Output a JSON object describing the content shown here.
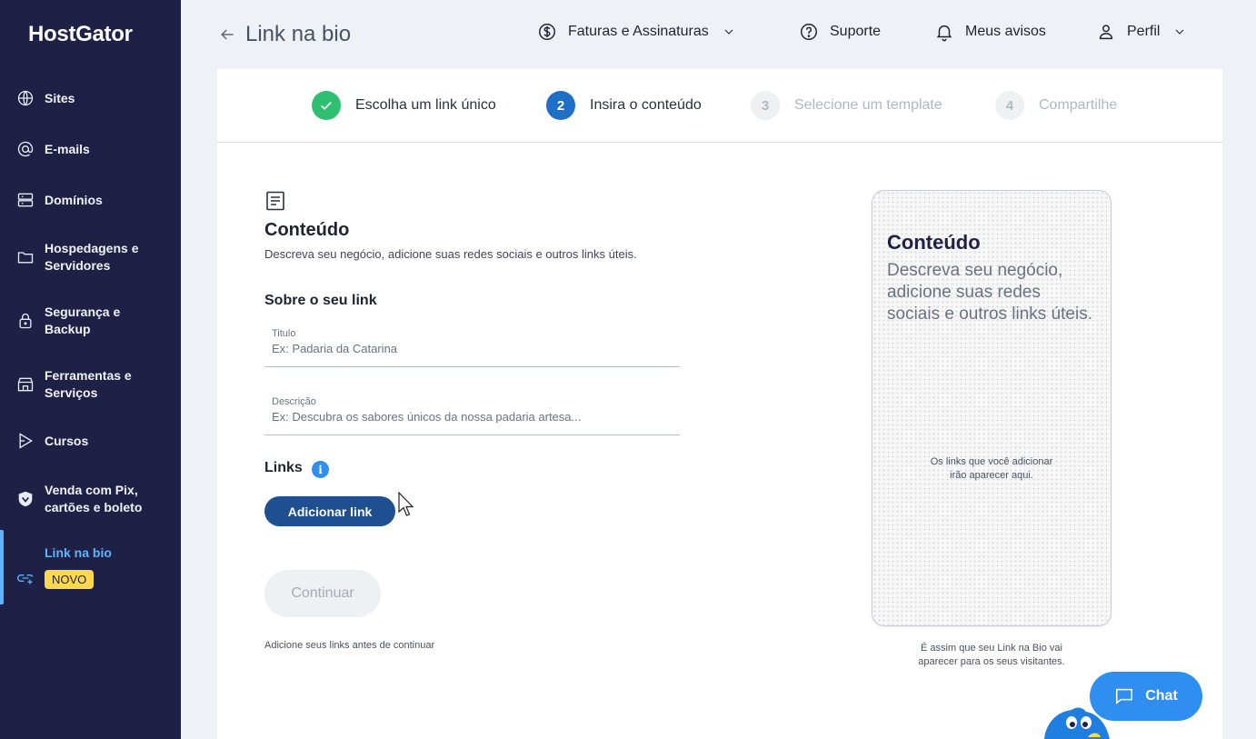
{
  "brand": {
    "logo": "HostGator"
  },
  "sidebar": {
    "items": [
      {
        "label": "Sites",
        "icon": "globe-icon"
      },
      {
        "label": "E-mails",
        "icon": "at-icon"
      },
      {
        "label": "Domínios",
        "icon": "server-icon"
      },
      {
        "label": "Hospedagens e Servidores",
        "icon": "folder-icon"
      },
      {
        "label": "Segurança e Backup",
        "icon": "lock-icon"
      },
      {
        "label": "Ferramentas e Serviços",
        "icon": "store-icon"
      },
      {
        "label": "Cursos",
        "icon": "play-icon"
      },
      {
        "label": "Venda com Pix, cartões e boleto",
        "icon": "shield-icon"
      },
      {
        "label": "Link na bio",
        "icon": "link-icon",
        "badge": "NOVO",
        "active": true
      }
    ]
  },
  "header": {
    "title": "Link na bio",
    "billing": "Faturas e Assinaturas",
    "support": "Suporte",
    "notices": "Meus avisos",
    "profile": "Perfil"
  },
  "steps": [
    {
      "number": "1",
      "label": "Escolha um link único",
      "state": "done"
    },
    {
      "number": "2",
      "label": "Insira o conteúdo",
      "state": "current"
    },
    {
      "number": "3",
      "label": "Selecione um template",
      "state": "todo"
    },
    {
      "number": "4",
      "label": "Compartilhe",
      "state": "todo"
    }
  ],
  "content": {
    "title": "Conteúdo",
    "description": "Descreva seu negócio, adicione suas redes sociais e outros links úteis.",
    "about_title": "Sobre o seu link",
    "title_field": {
      "label": "Titulo",
      "value": "",
      "placeholder": "Ex: Padaria da Catarina"
    },
    "description_field": {
      "label": "Descrição",
      "value": "",
      "placeholder": "Ex: Descubra os sabores únicos da nossa padaria artesa..."
    },
    "links_title": "Links",
    "info_icon": "i",
    "add_link": "Adicionar link",
    "continue": "Continuar",
    "hint": "Adicione seus links antes de continuar"
  },
  "preview": {
    "title": "Conteúdo",
    "description": "Descreva seu negócio, adicione suas redes sociais e outros links úteis.",
    "links_line1": "Os links que você adicionar",
    "links_line2": "irão aparecer aqui.",
    "caption_line1": "É assim que seu Link na Bio vai",
    "caption_line2": "aparecer para os seus visitantes."
  },
  "chat": {
    "label": "Chat"
  },
  "colors": {
    "sidebar_bg": "#1f2045",
    "accent": "#5fb3ff",
    "primary_button": "#1d4f91",
    "step_done": "#2fbf71",
    "step_current": "#1f6fc7",
    "chat": "#2f8ff0",
    "badge": "#ffd84d"
  }
}
